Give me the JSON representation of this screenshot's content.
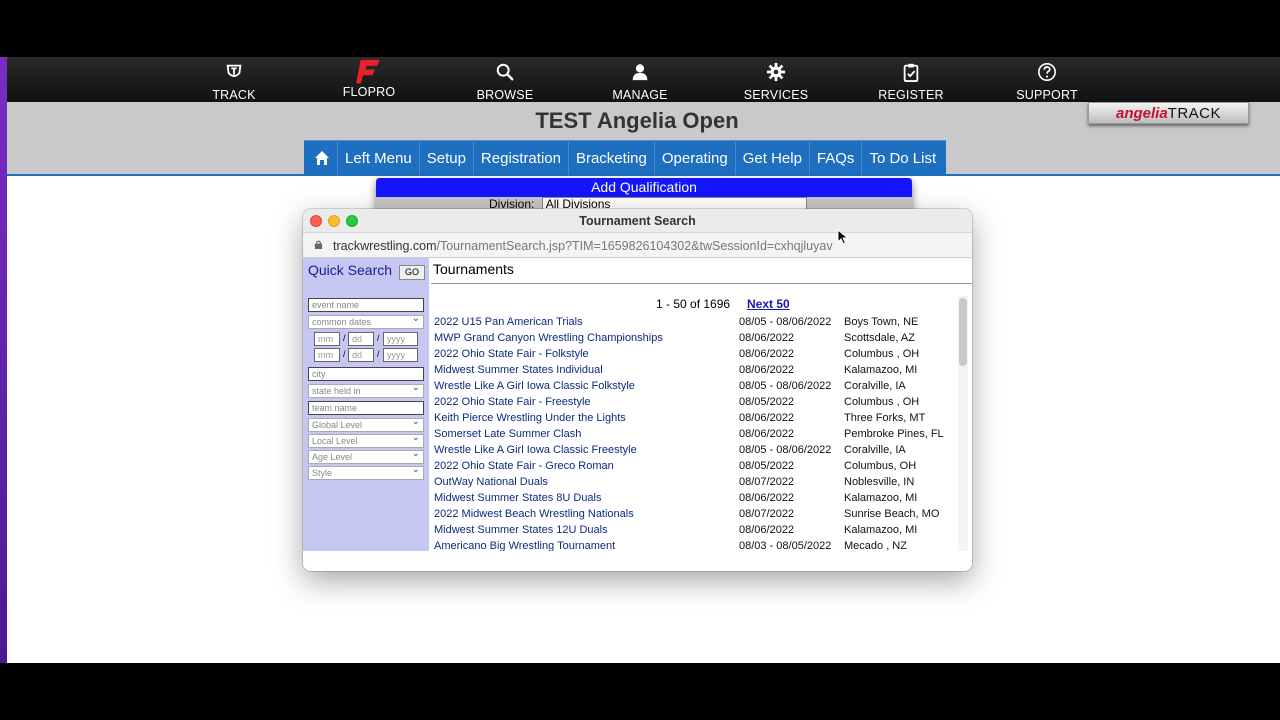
{
  "nav": {
    "items": [
      {
        "label": "TRACK",
        "icon": "track-logo-icon"
      },
      {
        "label": "FLOPRO",
        "icon": "flopro-logo-icon"
      },
      {
        "label": "BROWSE",
        "icon": "search-icon"
      },
      {
        "label": "MANAGE",
        "icon": "user-icon"
      },
      {
        "label": "SERVICES",
        "icon": "gear-icon"
      },
      {
        "label": "REGISTER",
        "icon": "clipboard-check-icon"
      },
      {
        "label": "SUPPORT",
        "icon": "help-circle-icon"
      }
    ]
  },
  "header": {
    "title": "TEST Angelia Open",
    "brand_a": "angelia",
    "brand_b": "TRACK"
  },
  "menu": {
    "items": [
      "Left Menu",
      "Setup",
      "Registration",
      "Bracketing",
      "Operating",
      "Get Help",
      "FAQs",
      "To Do List"
    ]
  },
  "qualification": {
    "title": "Add Qualification",
    "division_label": "Division:",
    "division_value": "All Divisions"
  },
  "popup": {
    "title": "Tournament Search",
    "url_host": "trackwrestling.com",
    "url_path": "/TournamentSearch.jsp?TIM=1659826104302&twSessionId=cxhqjluyav"
  },
  "sidebar": {
    "quick_search": "Quick Search",
    "go": "GO",
    "event_name_placeholder": "event name",
    "common_dates": "common dates",
    "mm": "mm",
    "dd": "dd",
    "yyyy": "yyyy",
    "city_placeholder": "city",
    "state": "state held in",
    "team_placeholder": "team name",
    "global_level": "Global Level",
    "local_level": "Local Level",
    "age_level": "Age Level",
    "style": "Style"
  },
  "results": {
    "heading": "Tournaments",
    "pager": "1 - 50 of 1696",
    "next": "Next 50",
    "rows": [
      {
        "name": "2022 U15 Pan American Trials",
        "date": "08/05 - 08/06/2022",
        "city": "Boys Town, NE"
      },
      {
        "name": "MWP Grand Canyon Wrestling Championships",
        "date": "08/06/2022",
        "city": "Scottsdale, AZ"
      },
      {
        "name": "2022 Ohio State Fair - Folkstyle",
        "date": "08/06/2022",
        "city": "Columbus , OH"
      },
      {
        "name": "Midwest Summer States Individual",
        "date": "08/06/2022",
        "city": "Kalamazoo, MI"
      },
      {
        "name": "Wrestle Like A Girl Iowa Classic Folkstyle",
        "date": "08/05 - 08/06/2022",
        "city": "Coralville, IA"
      },
      {
        "name": "2022 Ohio State Fair - Freestyle",
        "date": "08/05/2022",
        "city": "Columbus , OH"
      },
      {
        "name": "Keith Pierce Wrestling Under the Lights",
        "date": "08/06/2022",
        "city": "Three Forks, MT"
      },
      {
        "name": "Somerset Late Summer Clash",
        "date": "08/06/2022",
        "city": "Pembroke Pines, FL"
      },
      {
        "name": "Wrestle Like A Girl Iowa Classic Freestyle",
        "date": "08/05 - 08/06/2022",
        "city": "Coralville, IA"
      },
      {
        "name": "2022 Ohio State Fair - Greco Roman",
        "date": "08/05/2022",
        "city": "Columbus, OH"
      },
      {
        "name": "OutWay National Duals",
        "date": "08/07/2022",
        "city": "Noblesville, IN"
      },
      {
        "name": "Midwest Summer States 8U Duals",
        "date": "08/06/2022",
        "city": "Kalamazoo, MI"
      },
      {
        "name": "2022 Midwest Beach Wrestling Nationals",
        "date": "08/07/2022",
        "city": "Sunrise Beach, MO"
      },
      {
        "name": "Midwest Summer States 12U Duals",
        "date": "08/06/2022",
        "city": "Kalamazoo, MI"
      },
      {
        "name": "Americano Big Wrestling Tournament",
        "date": "08/03 - 08/05/2022",
        "city": "Mecado , NZ"
      }
    ]
  },
  "colors": {
    "nav_bg": "#111111",
    "menu_blue": "#1e6fbf",
    "qual_blue": "#1515ff",
    "sidebar_lavender": "#c6c6f2",
    "flopro_red": "#e8222a"
  }
}
